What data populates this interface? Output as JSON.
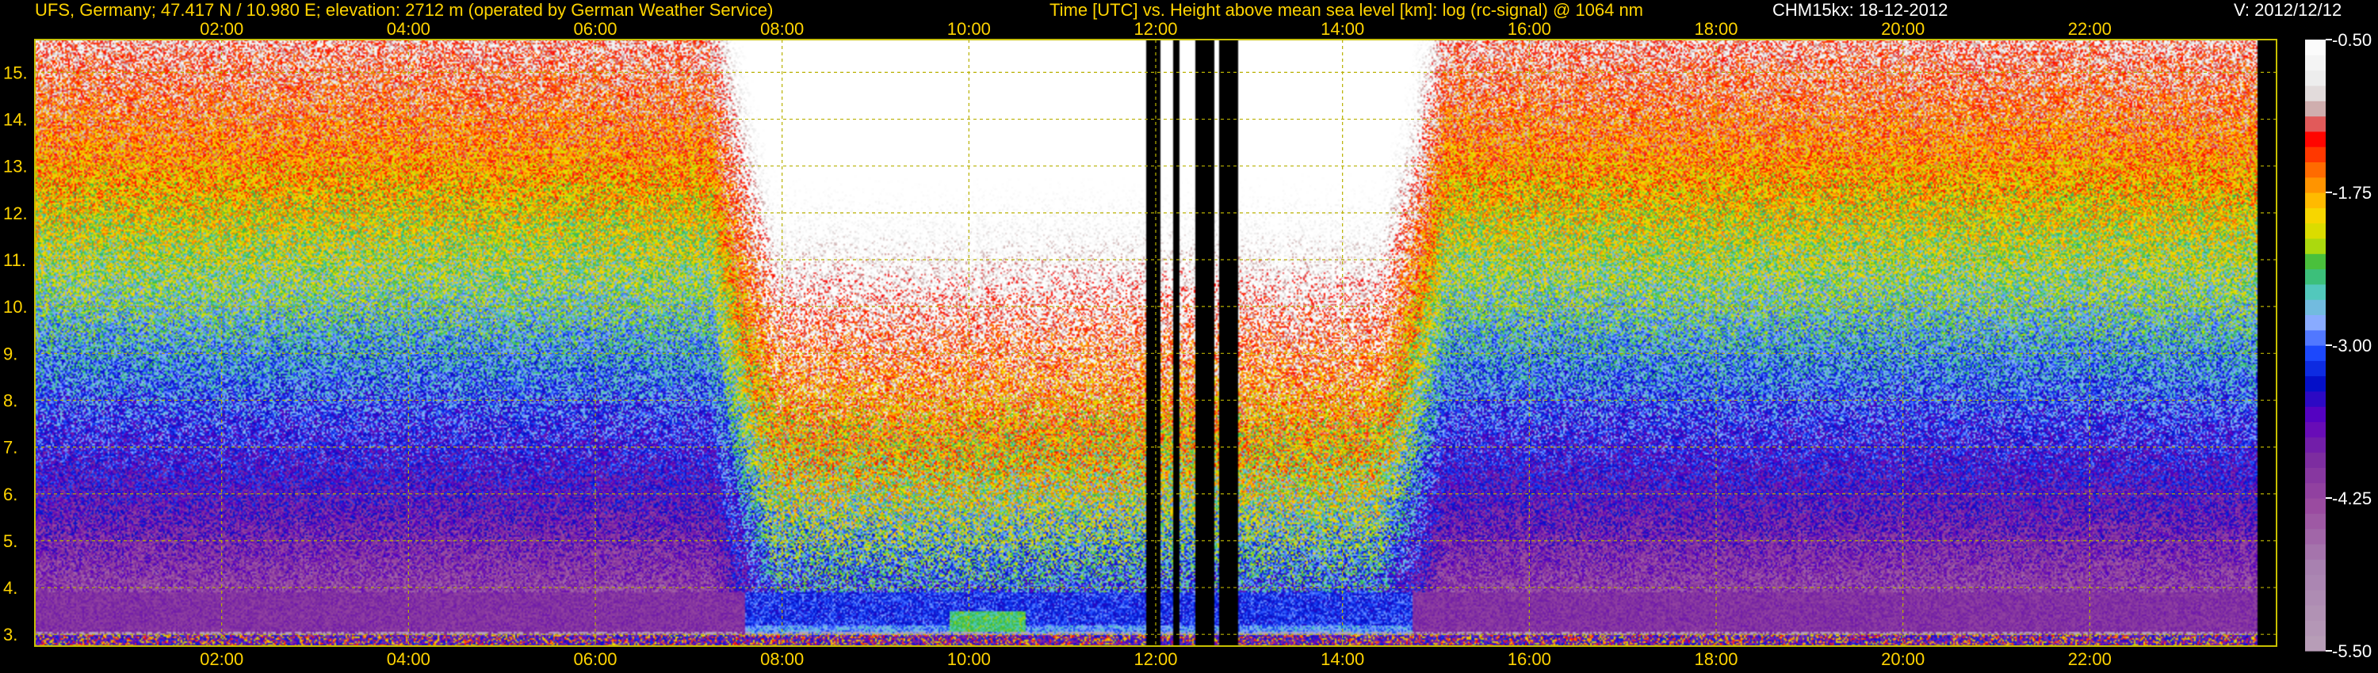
{
  "header": {
    "site": "UFS, Germany; 47.417 N / 10.980 E; elevation: 2712 m  (operated by German Weather Service)",
    "plot_title": "Time [UTC] vs. Height above mean sea level [km]: log (rc-signal) @ 1064 nm",
    "instrument": "CHM15kx: 18-12-2012",
    "version": "V: 2012/12/12"
  },
  "colors": {
    "text_primary": "#ffd400",
    "text_secondary": "#ffffff",
    "grid": "#b8b000",
    "background": "#000000"
  },
  "chart_data": {
    "type": "heatmap",
    "title": "Time [UTC] vs. Height above mean sea level [km]: log (rc-signal) @ 1064 nm",
    "xlabel": "",
    "ylabel": "",
    "x_unit": "hour UTC",
    "y_unit": "km",
    "xlim": [
      0,
      24
    ],
    "ylim": [
      2.75,
      15.7
    ],
    "x_ticks": [
      2,
      4,
      6,
      8,
      10,
      12,
      14,
      16,
      18,
      20,
      22
    ],
    "x_tick_labels": [
      "02:00",
      "04:00",
      "06:00",
      "08:00",
      "10:00",
      "12:00",
      "14:00",
      "16:00",
      "18:00",
      "20:00",
      "22:00"
    ],
    "y_ticks": [
      3,
      4,
      5,
      6,
      7,
      8,
      9,
      10,
      11,
      12,
      13,
      14,
      15
    ],
    "y_tick_labels": [
      "3.",
      "4.",
      "5.",
      "6.",
      "7.",
      "8.",
      "9.",
      "10.",
      "11.",
      "12.",
      "13.",
      "14.",
      "15."
    ],
    "grid": true,
    "colorbar": {
      "min": -5.5,
      "max": -0.5,
      "ticks": [
        -0.5,
        -1.75,
        -3.0,
        -4.25,
        -5.5
      ],
      "tick_labels": [
        "-0.50",
        "-1.75",
        "-3.00",
        "-4.25",
        "-5.50"
      ],
      "stops": [
        {
          "value": -0.5,
          "color": "#ffffff"
        },
        {
          "value": -0.9,
          "color": "#e8e8e8"
        },
        {
          "value": -1.1,
          "color": "#c9a0a0"
        },
        {
          "value": -1.3,
          "color": "#ff0000"
        },
        {
          "value": -1.6,
          "color": "#ff7a00"
        },
        {
          "value": -1.9,
          "color": "#ffd400"
        },
        {
          "value": -2.15,
          "color": "#c8e000"
        },
        {
          "value": -2.35,
          "color": "#2db84a"
        },
        {
          "value": -2.55,
          "color": "#4fc9b8"
        },
        {
          "value": -2.8,
          "color": "#8fb0ff"
        },
        {
          "value": -3.05,
          "color": "#1e4bff"
        },
        {
          "value": -3.3,
          "color": "#0010c8"
        },
        {
          "value": -3.6,
          "color": "#6000c0"
        },
        {
          "value": -3.9,
          "color": "#7a2aa0"
        },
        {
          "value": -4.3,
          "color": "#9a4aa0"
        },
        {
          "value": -4.8,
          "color": "#a880b0"
        },
        {
          "value": -5.5,
          "color": "#b8a0b8"
        }
      ]
    },
    "regimes": [
      {
        "start": 0.0,
        "end": 7.6,
        "sky": "night"
      },
      {
        "start": 7.6,
        "end": 14.75,
        "sky": "day"
      },
      {
        "start": 14.75,
        "end": 23.95,
        "sky": "night"
      }
    ],
    "data_gaps": [
      [
        11.9,
        12.05
      ],
      [
        12.18,
        12.26
      ],
      [
        12.42,
        12.62
      ],
      [
        12.68,
        12.88
      ],
      [
        23.8,
        24.0
      ]
    ]
  }
}
